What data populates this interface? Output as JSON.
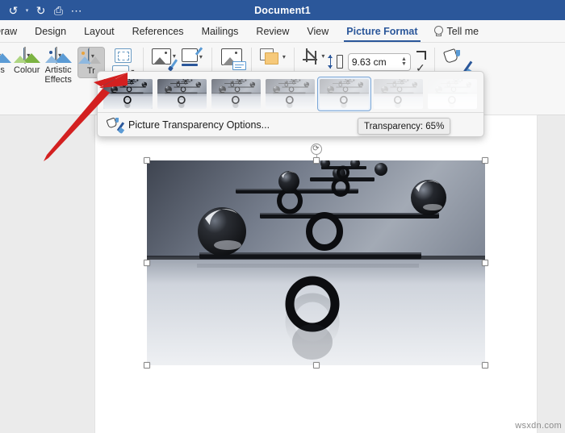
{
  "titlebar": {
    "document_title": "Document1",
    "bg_color": "#2b579a",
    "quick_access": [
      {
        "name": "undo-icon",
        "glyph": "↺"
      },
      {
        "name": "undo-dropdown-caret",
        "glyph": "▾"
      },
      {
        "name": "redo-icon",
        "glyph": "↻"
      },
      {
        "name": "print-icon",
        "glyph": "⎙"
      },
      {
        "name": "more-options-icon",
        "glyph": "⋯"
      }
    ]
  },
  "tabs": [
    {
      "label": "Draw",
      "active": false
    },
    {
      "label": "Design",
      "active": false
    },
    {
      "label": "Layout",
      "active": false
    },
    {
      "label": "References",
      "active": false
    },
    {
      "label": "Mailings",
      "active": false
    },
    {
      "label": "Review",
      "active": false
    },
    {
      "label": "View",
      "active": false
    },
    {
      "label": "Picture Format",
      "active": true
    }
  ],
  "tell_me": {
    "label": "Tell me",
    "icon": "lightbulb-icon"
  },
  "ribbon": {
    "accent_color": "#2b579a",
    "items": [
      {
        "name": "corrections",
        "label": "ons",
        "icon": "corrections-icon",
        "has_caret": true,
        "pressed": false
      },
      {
        "name": "colour",
        "label": "Colour",
        "icon": "colour-icon",
        "has_caret": true,
        "pressed": false
      },
      {
        "name": "artistic-effects",
        "label": "Artistic\nEffects",
        "icon": "artistic-effects-icon",
        "has_caret": true,
        "pressed": false
      },
      {
        "name": "transparency",
        "label": "Tr",
        "icon": "transparency-icon",
        "has_caret": true,
        "pressed": true
      },
      {
        "name": "remove-background",
        "label": "",
        "icon": "remove-background-icon",
        "has_caret": false,
        "pressed": false
      },
      {
        "name": "compress-pictures",
        "label": "",
        "icon": "compress-pictures-icon",
        "has_caret": false,
        "pressed": false
      },
      {
        "name": "picture-styles",
        "label": "",
        "icon": "picture-effects-icon",
        "has_caret": true,
        "pressed": false
      },
      {
        "name": "picture-border",
        "label": "",
        "icon": "picture-border-icon",
        "has_caret": true,
        "pressed": false
      },
      {
        "name": "alt-text",
        "label": "",
        "icon": "alt-text-icon",
        "has_caret": false,
        "pressed": false
      },
      {
        "name": "arrange",
        "label": "",
        "icon": "arrange-icon",
        "has_caret": true,
        "pressed": false
      },
      {
        "name": "crop",
        "label": "",
        "icon": "crop-icon",
        "has_caret": true,
        "pressed": false
      }
    ],
    "height_field": {
      "name": "shape-height",
      "value": "9.63 cm",
      "icon": "height-icon"
    },
    "format_pane": {
      "label": "Format\nPane",
      "icon": "format-pane-icon"
    }
  },
  "transparency_gallery": {
    "thumbnails": [
      {
        "name": "transparency-0",
        "transparency": 0,
        "selected": false
      },
      {
        "name": "transparency-15",
        "transparency": 15,
        "selected": false
      },
      {
        "name": "transparency-30",
        "transparency": 30,
        "selected": false
      },
      {
        "name": "transparency-50",
        "transparency": 50,
        "selected": false
      },
      {
        "name": "transparency-65",
        "transparency": 65,
        "selected": true
      },
      {
        "name": "transparency-80",
        "transparency": 80,
        "selected": false
      },
      {
        "name": "transparency-95",
        "transparency": 95,
        "selected": false
      }
    ],
    "options_label": "Picture Transparency Options...",
    "selected_border_color": "#7ba7d7"
  },
  "tooltip": {
    "text": "Transparency: 65%"
  },
  "document": {
    "watermark": "wsxdn.com",
    "picture": {
      "name": "balance-spheres-image",
      "alt": "Black spheres balanced on stacked seesaw beams",
      "selected": true,
      "handles": [
        "top-left",
        "top-center",
        "top-right",
        "middle-left",
        "middle-right",
        "bottom-left",
        "bottom-center",
        "bottom-right"
      ],
      "rotate_handle_icon": "rotate-icon"
    }
  },
  "annotation": {
    "name": "red-arrow",
    "color": "#d32020",
    "points_to": "transparency-button"
  }
}
